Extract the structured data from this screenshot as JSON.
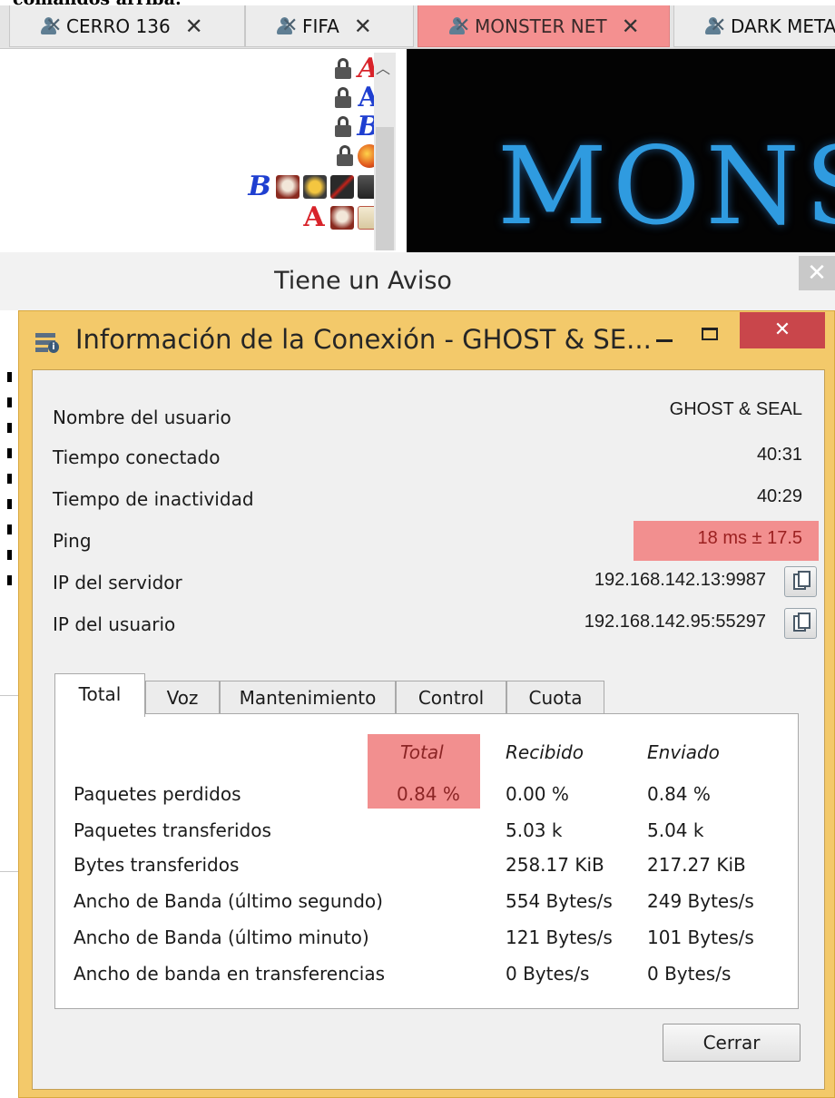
{
  "top_text": "comandos arriba:",
  "tabs": [
    {
      "label": "CERRO 136",
      "close": "✕"
    },
    {
      "label": "FIFA",
      "close": "✕"
    },
    {
      "label": "MONSTER NET",
      "close": "✕"
    },
    {
      "label": "DARK META",
      "close": ""
    }
  ],
  "banner_text": "MONS",
  "notice": {
    "title": "Tiene un Aviso",
    "close": "✕"
  },
  "dialog": {
    "title": "Información de la Conexión - GHOST & SE...",
    "close": "✕",
    "info": [
      {
        "label": "Nombre del usuario",
        "value": "GHOST & SEAL"
      },
      {
        "label": "Tiempo conectado",
        "value": "40:31"
      },
      {
        "label": "Tiempo de inactividad",
        "value": "40:29"
      },
      {
        "label": "Ping",
        "value": "18 ms ± 17.5"
      },
      {
        "label": "IP del servidor",
        "value": "192.168.142.13:9987"
      },
      {
        "label": "IP del usuario",
        "value": "192.168.142.95:55297"
      }
    ],
    "tabs": [
      "Total",
      "Voz",
      "Mantenimiento",
      "Control",
      "Cuota"
    ],
    "columns": [
      "Total",
      "Recibido",
      "Enviado"
    ],
    "rows": [
      {
        "label": "Paquetes perdidos",
        "total": "0.84 %",
        "recibido": "0.00 %",
        "enviado": "0.84 %"
      },
      {
        "label": "Paquetes transferidos",
        "total": "",
        "recibido": "5.03 k",
        "enviado": "5.04 k"
      },
      {
        "label": "Bytes transferidos",
        "total": "",
        "recibido": "258.17 KiB",
        "enviado": "217.27 KiB"
      },
      {
        "label": "Ancho de Banda (último segundo)",
        "total": "",
        "recibido": "554 Bytes/s",
        "enviado": "249 Bytes/s"
      },
      {
        "label": "Ancho de Banda (último minuto)",
        "total": "",
        "recibido": "121 Bytes/s",
        "enviado": "101 Bytes/s"
      },
      {
        "label": "Ancho de banda en transferencias",
        "total": "",
        "recibido": "0 Bytes/s",
        "enviado": "0 Bytes/s"
      }
    ],
    "close_button": "Cerrar"
  },
  "icon_glyphs": {
    "a": "A",
    "b": "B"
  },
  "colors": {
    "highlight": "#f28f8f",
    "dialog_frame": "#f3c96a",
    "close_red": "#c9464b",
    "banner_blue": "#2f9be0"
  }
}
